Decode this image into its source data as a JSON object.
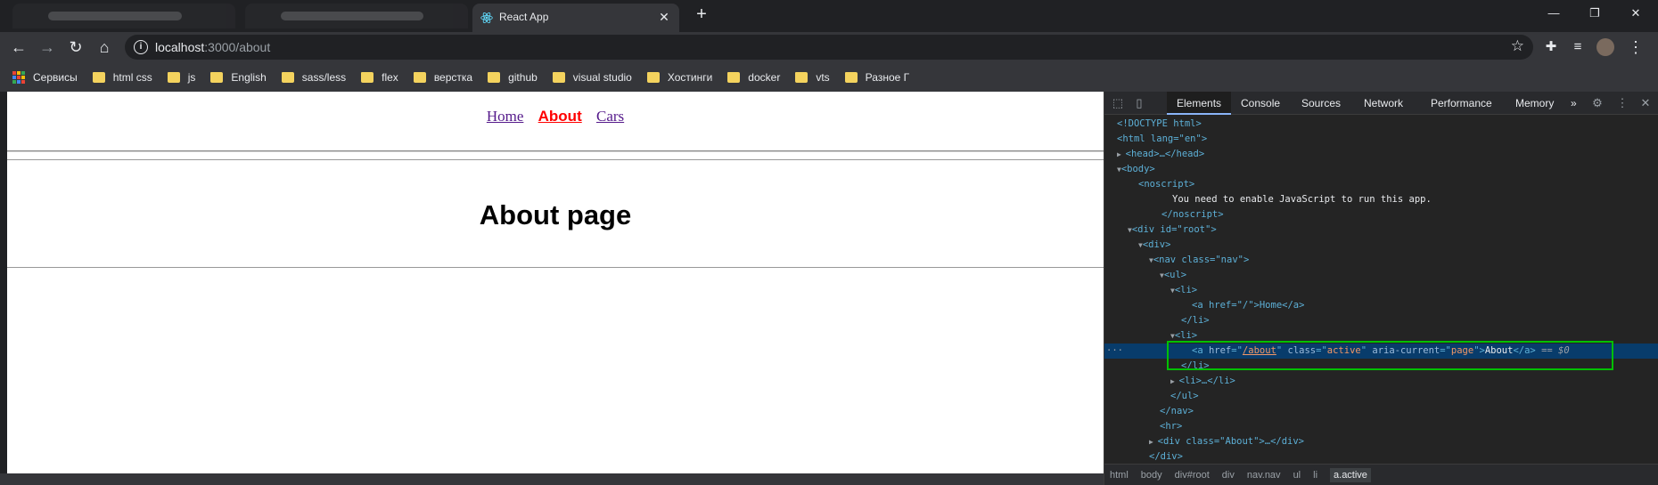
{
  "browser": {
    "tab_title": "React App",
    "tab_close": "✕",
    "new_tab": "+",
    "window_controls": {
      "minimize": "—",
      "restore": "❐",
      "close": "✕"
    },
    "url_host": "localhost",
    "url_path": ":3000/about",
    "bookmarks": [
      {
        "label": "Сервисы",
        "icon": "apps-icon"
      },
      {
        "label": "html css",
        "icon": "folder-icon"
      },
      {
        "label": "js",
        "icon": "folder-icon"
      },
      {
        "label": "English",
        "icon": "folder-icon"
      },
      {
        "label": "sass/less",
        "icon": "folder-icon"
      },
      {
        "label": "flex",
        "icon": "folder-icon"
      },
      {
        "label": "верстка",
        "icon": "folder-icon"
      },
      {
        "label": "github",
        "icon": "folder-icon"
      },
      {
        "label": "visual studio",
        "icon": "folder-icon"
      },
      {
        "label": "Хостинги",
        "icon": "folder-icon"
      },
      {
        "label": "docker",
        "icon": "folder-icon"
      },
      {
        "label": "vts",
        "icon": "folder-icon"
      },
      {
        "label": "Разное Г",
        "icon": "folder-icon"
      }
    ]
  },
  "page": {
    "nav": {
      "home": "Home",
      "about": "About",
      "cars": "Cars"
    },
    "heading": "About page"
  },
  "devtools": {
    "tabs": [
      "Elements",
      "Console",
      "Sources",
      "Network",
      "Performance",
      "Memory",
      "»"
    ],
    "active_tab": "Elements",
    "breadcrumbs": [
      "html",
      "body",
      "div#root",
      "div",
      "nav.nav",
      "ul",
      "li",
      "a.active"
    ],
    "dom_lines": {
      "doctype": "<!DOCTYPE html>",
      "html_open": "<html lang=\"en\">",
      "head": "<head>…</head>",
      "body_open": "<body>",
      "noscript_open": "<noscript>",
      "noscript_text": "You need to enable JavaScript to run this app.",
      "noscript_close": "</noscript>",
      "root_open": "<div id=\"root\">",
      "div_open": "<div>",
      "nav_open": "<nav class=\"nav\">",
      "ul_open": "<ul>",
      "li1_open": "<li>",
      "a_home": "<a href=\"/\">Home</a>",
      "li1_close": "</li>",
      "li2_open": "<li>",
      "a_about_href": "/about",
      "a_about_class": "active",
      "a_about_aria": "page",
      "a_about_text": "About",
      "selected_marker": "== $0",
      "li2_close": "</li>",
      "li3": "<li>…</li>",
      "ul_close": "</ul>",
      "nav_close": "</nav>",
      "hr": "<hr>",
      "about_div": "<div class=\"About\">…</div>",
      "div_close": "</div>"
    }
  },
  "colors": {
    "highlight_box": "#00c000",
    "active_link": "#ff0000",
    "visited_link": "#551a8b"
  }
}
